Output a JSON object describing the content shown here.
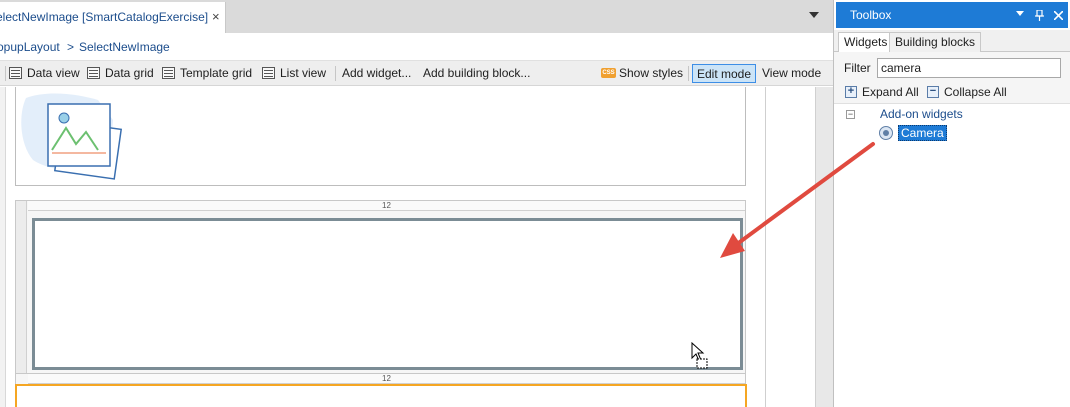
{
  "editor": {
    "tab_title": "electNewImage [SmartCatalogExercise]",
    "tab_close": "×",
    "breadcrumb": {
      "parent": "opupLayout",
      "separator": ">",
      "current": "SelectNewImage"
    },
    "toolbar": {
      "data_view": "Data view",
      "data_grid": "Data grid",
      "template_grid": "Template grid",
      "list_view": "List view",
      "add_widget": "Add widget...",
      "add_building_block": "Add building block...",
      "show_styles": "Show styles",
      "edit_mode": "Edit mode",
      "view_mode": "View mode"
    },
    "css_badge": "CSS",
    "column_size_1": "12",
    "column_size_2": "12"
  },
  "toolbox": {
    "title": "Toolbox",
    "tabs": [
      "Widgets",
      "Building blocks"
    ],
    "filter_label": "Filter",
    "filter_value": "camera",
    "expand_all": "Expand All",
    "collapse_all": "Collapse All",
    "group_label": "Add-on widgets",
    "items": [
      {
        "label": "Camera",
        "icon": "camera-icon",
        "selected": true
      }
    ],
    "controls": [
      "chevron-down-icon",
      "pin-icon",
      "close-icon"
    ]
  },
  "colors": {
    "accent": "#1e7bd6",
    "link_text": "#1c4d8c",
    "drop_highlight": "#f5a623",
    "annotation_arrow": "#e04a3f"
  }
}
